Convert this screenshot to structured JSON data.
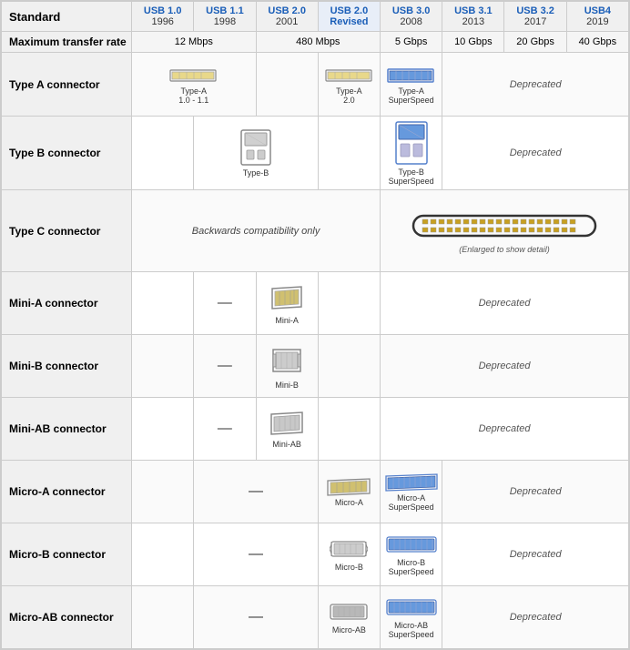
{
  "table": {
    "columns": [
      {
        "id": "standard",
        "label": "Standard"
      },
      {
        "id": "usb10",
        "label": "USB 1.0",
        "year": "1996",
        "color": "#1a5eb8"
      },
      {
        "id": "usb11",
        "label": "USB 1.1",
        "year": "1998",
        "color": "#1a5eb8"
      },
      {
        "id": "usb20",
        "label": "USB 2.0",
        "year": "2001",
        "color": "#1a5eb8"
      },
      {
        "id": "usb20r",
        "label": "USB 2.0",
        "sublabel": "Revised",
        "color": "#1a5eb8"
      },
      {
        "id": "usb30",
        "label": "USB 3.0",
        "year": "2008",
        "color": "#1a5eb8"
      },
      {
        "id": "usb31",
        "label": "USB 3.1",
        "year": "2013",
        "color": "#1a5eb8"
      },
      {
        "id": "usb32",
        "label": "USB 3.2",
        "year": "2017",
        "color": "#1a5eb8"
      },
      {
        "id": "usb4",
        "label": "USB4",
        "year": "2019",
        "color": "#1a5eb8"
      }
    ],
    "rows": [
      {
        "id": "transfer",
        "label": "Maximum transfer rate",
        "cells": {
          "usb10_usb11": {
            "colspan": 2,
            "value": "12 Mbps"
          },
          "usb20_usb20r": {
            "colspan": 2,
            "value": "480 Mbps"
          },
          "usb30": "5 Gbps",
          "usb31": "10 Gbps",
          "usb32": "20 Gbps",
          "usb4": "40 Gbps"
        }
      },
      {
        "id": "type_a",
        "label": "Type A connector",
        "cells": {
          "usb10": "type_a_1",
          "usb20r": "type_a_2",
          "usb30": "type_a_ss",
          "usb31_usb32_usb4": {
            "colspan": 3,
            "value": "Deprecated"
          }
        }
      },
      {
        "id": "type_b",
        "label": "Type B connector",
        "cells": {
          "usb11": "type_b",
          "usb30": "type_b_ss",
          "usb31_usb32_usb4": {
            "colspan": 3,
            "value": "Deprecated"
          }
        }
      },
      {
        "id": "type_c",
        "label": "Type C connector",
        "cells": {
          "usb10_usb20r": {
            "colspan": 4,
            "value": "Backwards compatibility only"
          },
          "usb30_usb31": {
            "colspan": 2,
            "value": "type_c"
          },
          "usb32_usb4": {
            "colspan": 2,
            "value": ""
          }
        }
      },
      {
        "id": "mini_a",
        "label": "Mini-A connector",
        "cells": {
          "usb10": "",
          "usb11": "dash",
          "usb20": "mini_a",
          "usb30_usb4": {
            "colspan": 4,
            "value": "Deprecated"
          }
        }
      },
      {
        "id": "mini_b",
        "label": "Mini-B connector",
        "cells": {
          "usb10": "",
          "usb11": "dash",
          "usb20": "mini_b",
          "usb30_usb4": {
            "colspan": 4,
            "value": "Deprecated"
          }
        }
      },
      {
        "id": "mini_ab",
        "label": "Mini-AB connector",
        "cells": {
          "usb10": "",
          "usb11": "dash",
          "usb20": "mini_ab",
          "usb30_usb4": {
            "colspan": 4,
            "value": "Deprecated"
          }
        }
      },
      {
        "id": "micro_a",
        "label": "Micro-A connector",
        "cells": {
          "usb10": "",
          "usb11_usb20": {
            "colspan": 2,
            "value": "dash"
          },
          "usb20r": "micro_a",
          "usb30": "micro_a_ss",
          "usb31_usb32_usb4": {
            "colspan": 3,
            "value": "Deprecated"
          }
        }
      },
      {
        "id": "micro_b",
        "label": "Micro-B connector",
        "cells": {
          "usb10": "",
          "usb11_usb20": {
            "colspan": 2,
            "value": "dash"
          },
          "usb20r": "micro_b",
          "usb30": "micro_b_ss",
          "usb31_usb32_usb4": {
            "colspan": 3,
            "value": "Deprecated"
          }
        }
      },
      {
        "id": "micro_ab",
        "label": "Micro-AB connector",
        "cells": {
          "usb10": "",
          "usb11_usb20": {
            "colspan": 2,
            "value": "dash"
          },
          "usb20r": "micro_ab",
          "usb30": "micro_ab_ss",
          "usb31_usb32_usb4": {
            "colspan": 3,
            "value": "Deprecated"
          }
        }
      }
    ]
  }
}
